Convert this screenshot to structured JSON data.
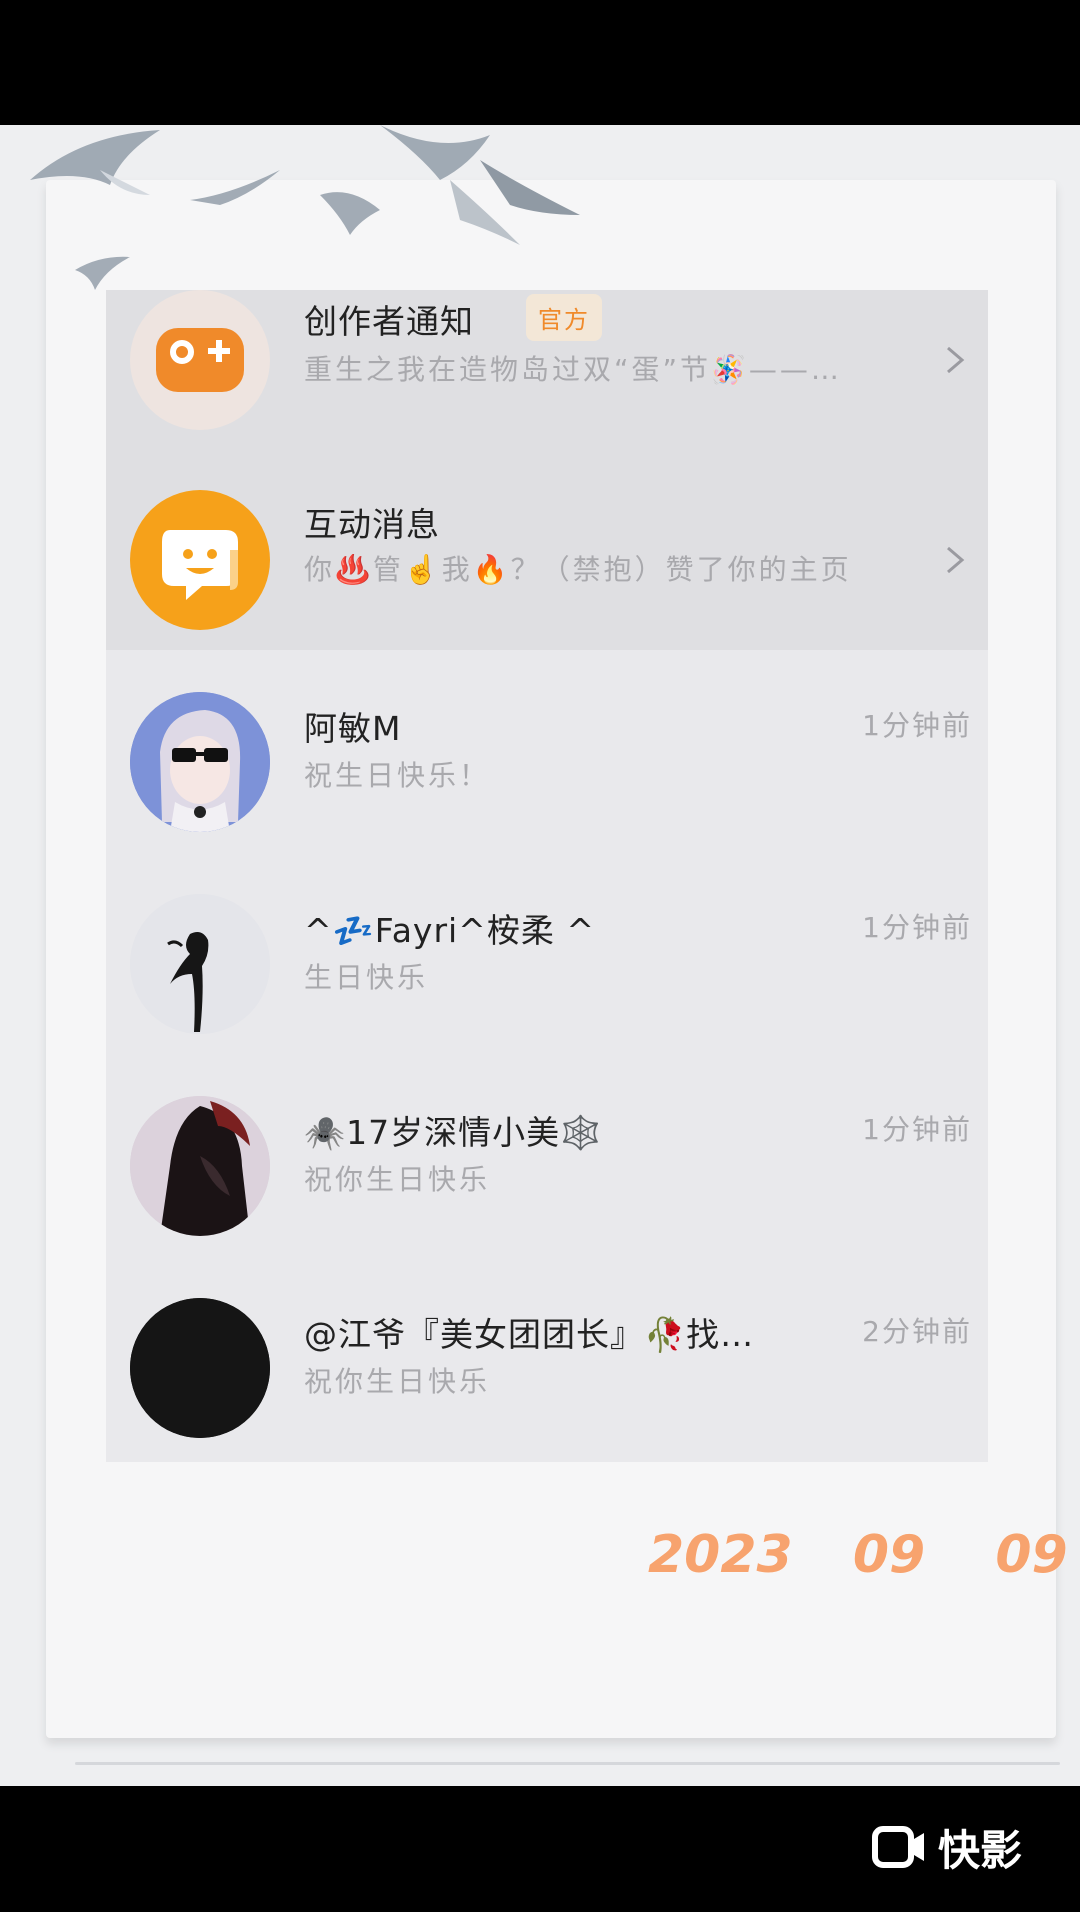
{
  "conversations": [
    {
      "name": "创作者通知",
      "badge": "官方",
      "preview": "重生之我在造物岛过双“蛋”节🪅——…",
      "time": "",
      "has_chevron": true,
      "avatar": "game-controller-icon",
      "avatar_color": "#f08a2a"
    },
    {
      "name": "互动消息",
      "badge": "",
      "preview": "你♨️管☝️我🔥？（禁抱）赞了你的主页",
      "time": "",
      "has_chevron": true,
      "avatar": "chat-bubble-icon",
      "avatar_color": "#f6a11a"
    },
    {
      "name": "阿敏M",
      "badge": "",
      "preview": "祝生日快乐！",
      "time": "1分钟前",
      "has_chevron": false,
      "avatar": "anime-avatar"
    },
    {
      "name": "^💤Fayri^桉柔 ^",
      "badge": "",
      "preview": "生日快乐",
      "time": "1分钟前",
      "has_chevron": false,
      "avatar": "silhouette-avatar"
    },
    {
      "name": "🕷️17岁深情小美🕸️",
      "badge": "",
      "preview": "祝你生日快乐",
      "time": "1分钟前",
      "has_chevron": false,
      "avatar": "dark-figure-avatar"
    },
    {
      "name": "@江爷『美女团团长』🥀找…",
      "badge": "",
      "preview": "祝你生日快乐",
      "time": "2分钟前",
      "has_chevron": false,
      "avatar": "black-avatar"
    }
  ],
  "date_stamp": {
    "year": "2023",
    "month": "09",
    "day": "09"
  },
  "watermark": {
    "label": "快影",
    "icon": "kuaiying-logo-icon"
  },
  "colors": {
    "date": "#f7a36e",
    "badge_text": "#f08a2a",
    "card_bg": "#e9e9ec"
  }
}
